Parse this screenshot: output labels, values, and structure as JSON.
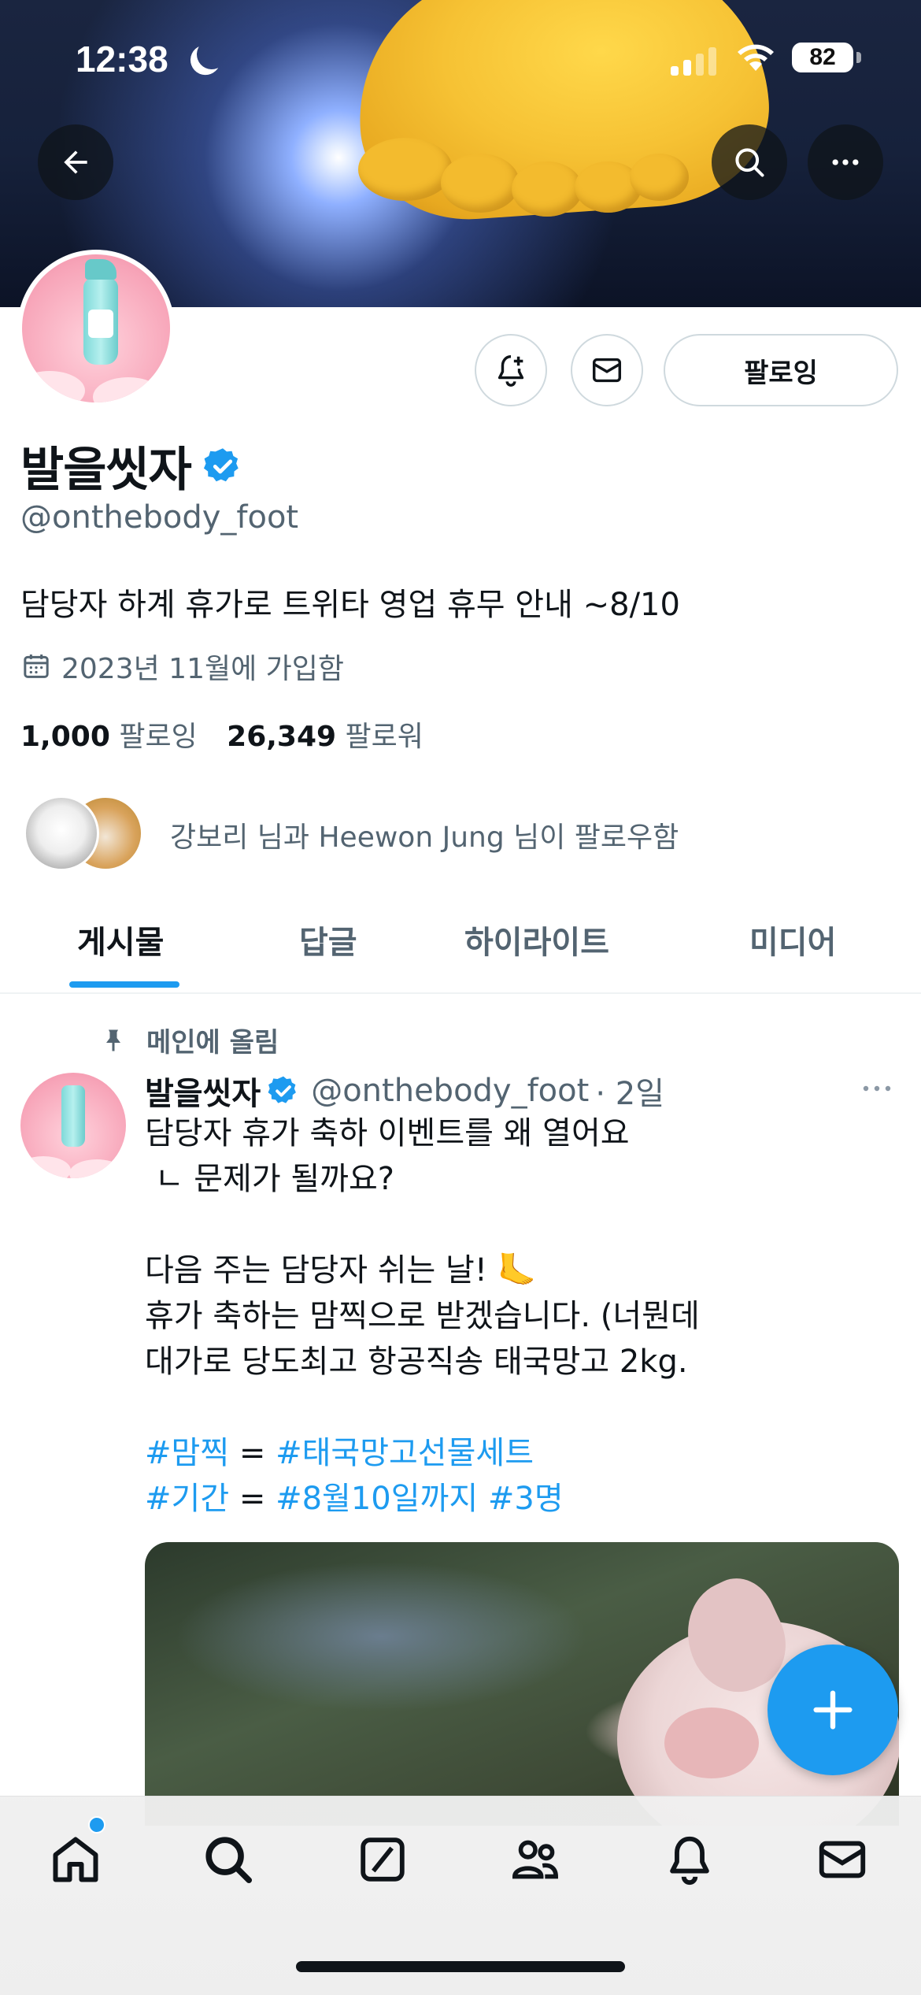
{
  "status_bar": {
    "time": "12:38",
    "battery": "82"
  },
  "header": {
    "back_icon": "arrow-left-icon",
    "search_icon": "search-icon",
    "more_icon": "more-horizontal-icon"
  },
  "profile": {
    "display_name": "발을씻자",
    "handle": "@onthebody_foot",
    "bio": "담당자 하계 휴가로 트위타 영업 휴무 안내 ~8/10",
    "joined": "2023년 11월에 가입함",
    "following_count": "1,000",
    "following_label": "팔로잉",
    "followers_count": "26,349",
    "followers_label": "팔로워",
    "follow_button": "팔로잉",
    "known_followers": "강보리 님과 Heewon Jung 님이 팔로우함"
  },
  "tabs": [
    {
      "label": "게시물",
      "active": true
    },
    {
      "label": "답글",
      "active": false
    },
    {
      "label": "하이라이트",
      "active": false
    },
    {
      "label": "미디어",
      "active": false
    }
  ],
  "tweet": {
    "pinned_label": "메인에 올림",
    "author_name": "발을씻자",
    "author_handle": "@onthebody_foot",
    "time": "· 2일",
    "line1": "담당자 휴가 축하 이벤트를 왜 열어요",
    "line2": " ㄴ 문제가 될까요?",
    "line3": "다음 주는 담당자 쉬는 날! 🦶",
    "line4": "휴가 축하는 맘찍으로 받겠습니다. (너뭔데",
    "line5": "대가로 당도최고 항공직송 태국망고 2kg.",
    "tag1": "#맘찍",
    "eq1": " = ",
    "tag2": "#태국망고선물세트",
    "tag3": "#기간",
    "eq2": " = ",
    "tag4": "#8월10일까지",
    "tag5": "#3명"
  },
  "colors": {
    "accent": "#1d9bf0",
    "text": "#0f1419",
    "muted": "#536471"
  },
  "bottom_nav": [
    "home-icon",
    "search-icon",
    "grok-icon",
    "communities-icon",
    "notifications-icon",
    "messages-icon"
  ]
}
